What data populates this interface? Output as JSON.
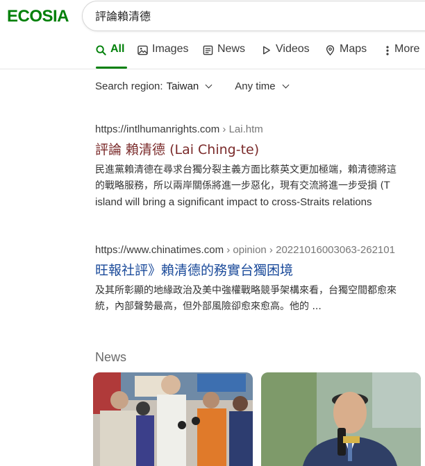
{
  "brand": {
    "logo_text": "ECOSIA",
    "color": "#008009"
  },
  "search": {
    "query": "評論賴清德"
  },
  "tabs": [
    {
      "label": "All",
      "icon": "search-icon",
      "active": true
    },
    {
      "label": "Images",
      "icon": "image-icon",
      "active": false
    },
    {
      "label": "News",
      "icon": "news-icon",
      "active": false
    },
    {
      "label": "Videos",
      "icon": "play-icon",
      "active": false
    },
    {
      "label": "Maps",
      "icon": "map-pin-icon",
      "active": false
    },
    {
      "label": "More",
      "icon": "more-vertical-icon",
      "active": false
    }
  ],
  "filters": {
    "region_label": "Search region:",
    "region_value": "Taiwan",
    "time_value": "Any time"
  },
  "results": [
    {
      "url": "https://intlhumanrights.com",
      "path": " › Lai.htm",
      "title": "評論 賴清德 (Lai Ching-te)",
      "snippet_lines": [
        "民進黨賴清德在尋求台獨分裂主義方面比蔡英文更加極端，賴清德將這",
        "的戰略服務，所以兩岸關係將進一步惡化，現有交流將進一步受損 (T",
        "island will bring a significant impact to cross-Straits relations"
      ]
    },
    {
      "url": "https://www.chinatimes.com",
      "path": " › opinion › 20221016003063-262101",
      "title": "旺報社評》賴清德的務實台獨困境",
      "snippet_lines": [
        "及其所彰顯的地緣政治及美中強權戰略競爭架構來看，台獨空間都愈來",
        "統，內部聲勢最高，但外部風險卻愈來愈高。他的 ..."
      ]
    }
  ],
  "news": {
    "heading": "News",
    "cards": [
      {
        "image": "press-conference-photo"
      },
      {
        "image": "politician-portrait-photo"
      }
    ]
  }
}
